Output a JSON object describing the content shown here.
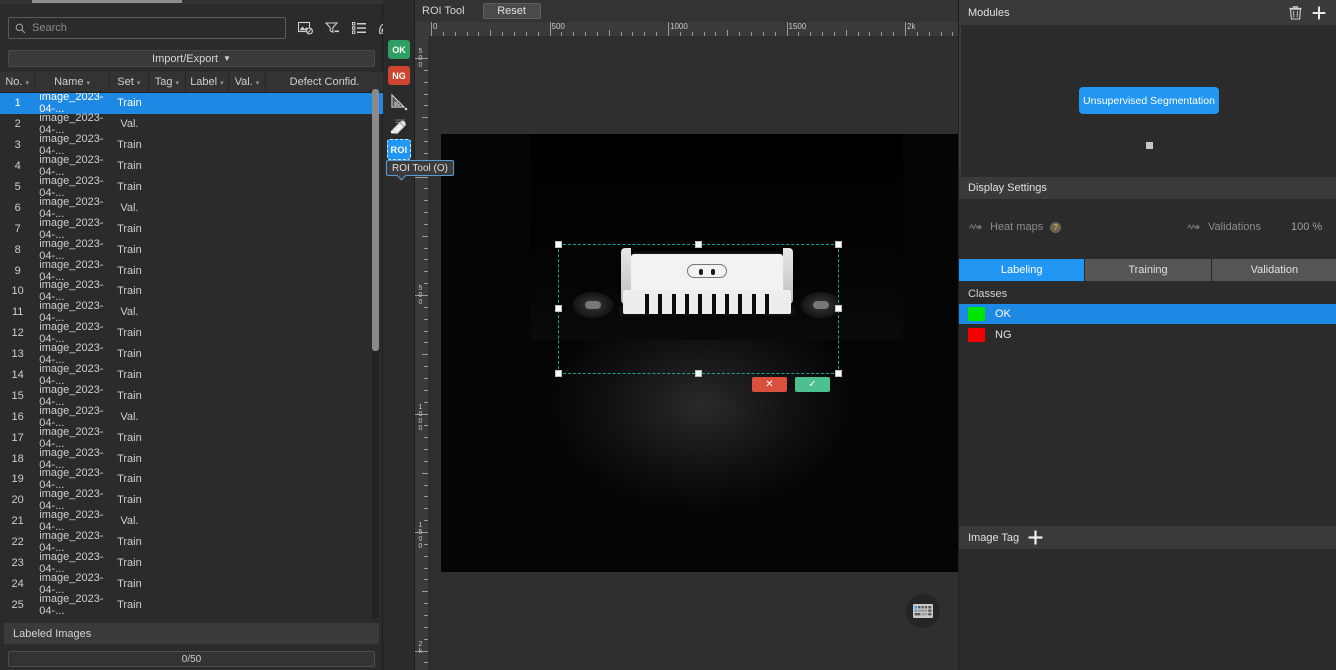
{
  "left_panel": {
    "search": {
      "placeholder": "Search",
      "value": "",
      "icon": "search-icon"
    },
    "toolbar_icons": [
      {
        "name": "image-filter-icon",
        "label": "Image Filter"
      },
      {
        "name": "funnel-filter-icon",
        "label": "Filter"
      },
      {
        "name": "list-view-icon",
        "label": "List View"
      },
      {
        "name": "panel-layout-icon",
        "label": "Layout"
      }
    ],
    "import_export": {
      "label": "Import/Export",
      "caret": "▼"
    },
    "table": {
      "columns": [
        {
          "key": "no",
          "label": "No.",
          "sortable": true
        },
        {
          "key": "name",
          "label": "Name",
          "sortable": true
        },
        {
          "key": "set",
          "label": "Set",
          "sortable": true
        },
        {
          "key": "tag",
          "label": "Tag",
          "sortable": true
        },
        {
          "key": "label",
          "label": "Label",
          "sortable": true
        },
        {
          "key": "val",
          "label": "Val.",
          "sortable": true
        },
        {
          "key": "defect",
          "label": "Defect Confid.",
          "sortable": false
        }
      ],
      "rows": [
        {
          "no": "1",
          "name": "image_2023-04-...",
          "set": "Train",
          "tag": "",
          "label": "",
          "val": "",
          "defect": "",
          "selected": true
        },
        {
          "no": "2",
          "name": "image_2023-04-...",
          "set": "Val.",
          "tag": "",
          "label": "",
          "val": "",
          "defect": "",
          "selected": false
        },
        {
          "no": "3",
          "name": "image_2023-04-...",
          "set": "Train",
          "tag": "",
          "label": "",
          "val": "",
          "defect": "",
          "selected": false
        },
        {
          "no": "4",
          "name": "image_2023-04-...",
          "set": "Train",
          "tag": "",
          "label": "",
          "val": "",
          "defect": "",
          "selected": false
        },
        {
          "no": "5",
          "name": "image_2023-04-...",
          "set": "Train",
          "tag": "",
          "label": "",
          "val": "",
          "defect": "",
          "selected": false
        },
        {
          "no": "6",
          "name": "image_2023-04-...",
          "set": "Val.",
          "tag": "",
          "label": "",
          "val": "",
          "defect": "",
          "selected": false
        },
        {
          "no": "7",
          "name": "image_2023-04-...",
          "set": "Train",
          "tag": "",
          "label": "",
          "val": "",
          "defect": "",
          "selected": false
        },
        {
          "no": "8",
          "name": "image_2023-04-...",
          "set": "Train",
          "tag": "",
          "label": "",
          "val": "",
          "defect": "",
          "selected": false
        },
        {
          "no": "9",
          "name": "image_2023-04-...",
          "set": "Train",
          "tag": "",
          "label": "",
          "val": "",
          "defect": "",
          "selected": false
        },
        {
          "no": "10",
          "name": "image_2023-04-...",
          "set": "Train",
          "tag": "",
          "label": "",
          "val": "",
          "defect": "",
          "selected": false
        },
        {
          "no": "11",
          "name": "image_2023-04-...",
          "set": "Val.",
          "tag": "",
          "label": "",
          "val": "",
          "defect": "",
          "selected": false
        },
        {
          "no": "12",
          "name": "image_2023-04-...",
          "set": "Train",
          "tag": "",
          "label": "",
          "val": "",
          "defect": "",
          "selected": false
        },
        {
          "no": "13",
          "name": "image_2023-04-...",
          "set": "Train",
          "tag": "",
          "label": "",
          "val": "",
          "defect": "",
          "selected": false
        },
        {
          "no": "14",
          "name": "image_2023-04-...",
          "set": "Train",
          "tag": "",
          "label": "",
          "val": "",
          "defect": "",
          "selected": false
        },
        {
          "no": "15",
          "name": "image_2023-04-...",
          "set": "Train",
          "tag": "",
          "label": "",
          "val": "",
          "defect": "",
          "selected": false
        },
        {
          "no": "16",
          "name": "image_2023-04-...",
          "set": "Val.",
          "tag": "",
          "label": "",
          "val": "",
          "defect": "",
          "selected": false
        },
        {
          "no": "17",
          "name": "image_2023-04-...",
          "set": "Train",
          "tag": "",
          "label": "",
          "val": "",
          "defect": "",
          "selected": false
        },
        {
          "no": "18",
          "name": "image_2023-04-...",
          "set": "Train",
          "tag": "",
          "label": "",
          "val": "",
          "defect": "",
          "selected": false
        },
        {
          "no": "19",
          "name": "image_2023-04-...",
          "set": "Train",
          "tag": "",
          "label": "",
          "val": "",
          "defect": "",
          "selected": false
        },
        {
          "no": "20",
          "name": "image_2023-04-...",
          "set": "Train",
          "tag": "",
          "label": "",
          "val": "",
          "defect": "",
          "selected": false
        },
        {
          "no": "21",
          "name": "image_2023-04-...",
          "set": "Val.",
          "tag": "",
          "label": "",
          "val": "",
          "defect": "",
          "selected": false
        },
        {
          "no": "22",
          "name": "image_2023-04-...",
          "set": "Train",
          "tag": "",
          "label": "",
          "val": "",
          "defect": "",
          "selected": false
        },
        {
          "no": "23",
          "name": "image_2023-04-...",
          "set": "Train",
          "tag": "",
          "label": "",
          "val": "",
          "defect": "",
          "selected": false
        },
        {
          "no": "24",
          "name": "image_2023-04-...",
          "set": "Train",
          "tag": "",
          "label": "",
          "val": "",
          "defect": "",
          "selected": false
        },
        {
          "no": "25",
          "name": "image_2023-04-...",
          "set": "Train",
          "tag": "",
          "label": "",
          "val": "",
          "defect": "",
          "selected": false
        }
      ]
    },
    "labeled_images": {
      "title": "Labeled Images",
      "progress_text": "0/50",
      "done": 0,
      "total": 50
    }
  },
  "tool_rail": {
    "tools": [
      {
        "name": "ok-class-tool",
        "label": "OK",
        "color": "#2e9e63",
        "active": false
      },
      {
        "name": "ng-class-tool",
        "label": "NG",
        "color": "#cf4430",
        "active": false
      },
      {
        "name": "polygon-tool",
        "label": "",
        "active": false
      },
      {
        "name": "eraser-tool",
        "label": "",
        "active": false
      },
      {
        "name": "roi-tool",
        "label": "ROI",
        "active": true
      }
    ],
    "tooltip": "ROI Tool (O)"
  },
  "canvas": {
    "header": {
      "title": "ROI Tool",
      "reset_label": "Reset"
    },
    "ruler_h_labels": [
      "0",
      "500",
      "1000",
      "1500",
      "2k"
    ],
    "ruler_v_labels": [
      "500",
      "0",
      "500",
      "1000",
      "1500",
      "2k"
    ],
    "roi_actions": {
      "cancel": "✕",
      "confirm": "✓"
    },
    "keyboard_shortcut_icon": "keyboard-icon"
  },
  "right_panel": {
    "modules": {
      "title": "Modules",
      "delete_icon": "trash-icon",
      "add_icon": "plus-icon",
      "nodes": [
        {
          "label": "Unsupervised Segmentation",
          "color": "#2196f3"
        }
      ]
    },
    "display_settings": {
      "title": "Display Settings",
      "heat_maps": {
        "label": "Heat maps",
        "help": "?",
        "enabled": false
      },
      "validations": {
        "label": "Validations",
        "enabled": false
      },
      "percent": "100 %"
    },
    "tabs": [
      {
        "label": "Labeling",
        "active": true
      },
      {
        "label": "Training",
        "active": false
      },
      {
        "label": "Validation",
        "active": false
      }
    ],
    "classes": {
      "title": "Classes",
      "items": [
        {
          "label": "OK",
          "color": "#00e500",
          "selected": true
        },
        {
          "label": "NG",
          "color": "#f50000",
          "selected": false
        }
      ]
    },
    "image_tag": {
      "title": "Image Tag",
      "add_icon": "plus-icon"
    }
  },
  "colors": {
    "accent": "#2196f3",
    "selection": "#1e88e5",
    "ok": "#00e500",
    "ng": "#f50000",
    "roi_border": "#18a39a"
  }
}
